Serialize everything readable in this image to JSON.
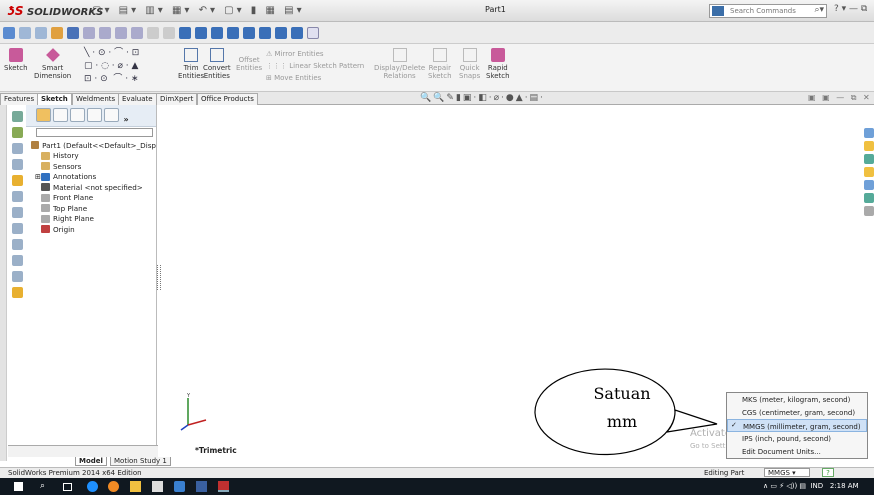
{
  "app": {
    "brand": "SOLIDWORKS",
    "doc_title": "Part1",
    "search_placeholder": "Search Commands",
    "win_controls": "? ▾ — ⧉"
  },
  "ribbon": {
    "sketch": "Sketch",
    "smart_dim": [
      "Smart",
      "Dimension"
    ],
    "trim": [
      "Trim",
      "Entities"
    ],
    "convert": [
      "Convert",
      "Entities"
    ],
    "offset": [
      "Offset",
      "Entities"
    ],
    "mirror": "Mirror Entities",
    "linear": "Linear Sketch Pattern",
    "move": "Move Entities",
    "display_delete": [
      "Display/Delete",
      "Relations"
    ],
    "repair": [
      "Repair",
      "Sketch"
    ],
    "quick": [
      "Quick",
      "Snaps"
    ],
    "rapid": [
      "Rapid",
      "Sketch"
    ]
  },
  "tabs": [
    "Features",
    "Sketch",
    "Weldments",
    "Evaluate",
    "DimXpert",
    "Office Products"
  ],
  "active_tab": "Sketch",
  "tree": [
    {
      "label": "Part1  (Default<<Default>_Disp",
      "icon": "part-icon",
      "color": "#b08040"
    },
    {
      "label": "History",
      "icon": "history-icon",
      "color": "#d8b060"
    },
    {
      "label": "Sensors",
      "icon": "sensors-icon",
      "color": "#d8b060"
    },
    {
      "label": "Annotations",
      "icon": "annotations-icon",
      "color": "#3070c0"
    },
    {
      "label": "Material <not specified>",
      "icon": "material-icon",
      "color": "#555"
    },
    {
      "label": "Front Plane",
      "icon": "plane-icon",
      "color": "#aaa"
    },
    {
      "label": "Top Plane",
      "icon": "plane-icon",
      "color": "#aaa"
    },
    {
      "label": "Right Plane",
      "icon": "plane-icon",
      "color": "#aaa"
    },
    {
      "label": "Origin",
      "icon": "origin-icon",
      "color": "#c04040"
    }
  ],
  "view": {
    "orientation": "*Trimetric"
  },
  "units_menu": [
    "MKS (meter, kilogram, second)",
    "CGS (centimeter, gram, second)",
    "MMGS (millimeter, gram, second)",
    "IPS (inch, pound, second)",
    "Edit Document Units..."
  ],
  "units_selected_index": 2,
  "callout": {
    "line1": "Satuan",
    "line2": "mm"
  },
  "activate": {
    "title": "Activate Windows",
    "sub": "Go to Settings to activate Windows."
  },
  "model_tabs": [
    "Model",
    "Motion Study 1"
  ],
  "status": {
    "edition": "SolidWorks Premium 2014 x64 Edition",
    "editing": "Editing Part",
    "units": "MMGS",
    "help": "?"
  },
  "tray": {
    "lang": "IND",
    "time": "2:18 AM"
  }
}
